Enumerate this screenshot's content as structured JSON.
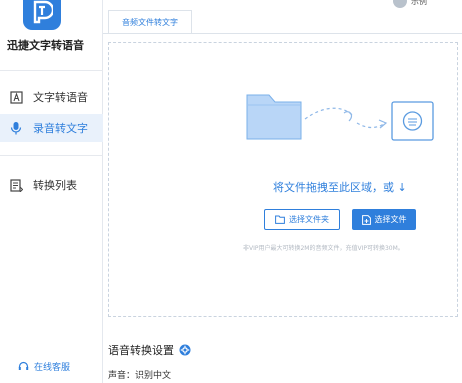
{
  "app": {
    "title": "迅捷文字转语音"
  },
  "user": {
    "name": "示例"
  },
  "sidebar": {
    "items": [
      {
        "label": "文字转语音",
        "icon": "text-doc-icon",
        "active": false
      },
      {
        "label": "录音转文字",
        "icon": "microphone-icon",
        "active": true
      },
      {
        "label": "转换列表",
        "icon": "list-icon",
        "active": false
      }
    ],
    "service_label": "在线客服"
  },
  "tab": {
    "label": "音频文件转文字"
  },
  "dropzone": {
    "hint": "将文件拖拽至此区域，或 ↓",
    "select_folder_label": "选择文件夹",
    "select_file_label": "选择文件",
    "note": "非VIP用户最大可转换2M的音频文件，充值VIP可转换30M。"
  },
  "settings": {
    "title": "语音转换设置",
    "voice_label": "声音：识别中文"
  },
  "colors": {
    "accent": "#2f7fdc",
    "folder": "#b9d6f7",
    "border": "#dde3ea"
  }
}
